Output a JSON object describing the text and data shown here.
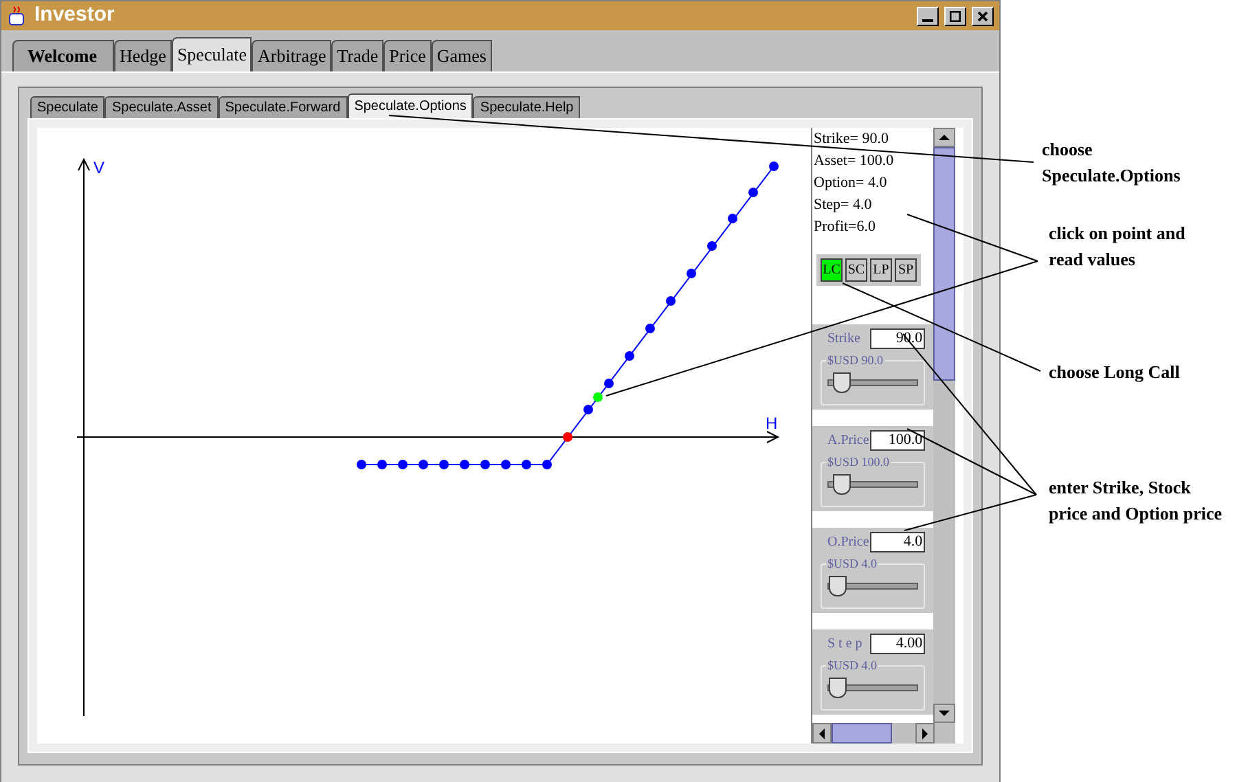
{
  "window": {
    "title": "Investor"
  },
  "main_tabs": [
    {
      "label": "Welcome",
      "selected": false,
      "bold": true
    },
    {
      "label": "Hedge",
      "selected": false,
      "bold": false
    },
    {
      "label": "Speculate",
      "selected": true,
      "bold": false
    },
    {
      "label": "Arbitrage",
      "selected": false,
      "bold": false
    },
    {
      "label": "Trade",
      "selected": false,
      "bold": false
    },
    {
      "label": "Price",
      "selected": false,
      "bold": false
    },
    {
      "label": "Games",
      "selected": false,
      "bold": false
    }
  ],
  "sub_tabs": [
    {
      "label": "Speculate",
      "selected": false
    },
    {
      "label": "Speculate.Asset",
      "selected": false
    },
    {
      "label": "Speculate.Forward",
      "selected": false
    },
    {
      "label": "Speculate.Options",
      "selected": true
    },
    {
      "label": "Speculate.Help",
      "selected": false
    }
  ],
  "plot": {
    "x_axis_label": "H",
    "y_axis_label": "V"
  },
  "readout": [
    "Strike= 90.0",
    "Asset= 100.0",
    "Option= 4.0",
    "Step= 4.0",
    "Profit=6.0"
  ],
  "position_buttons": [
    {
      "label": "LC",
      "selected": true
    },
    {
      "label": "SC",
      "selected": false
    },
    {
      "label": "LP",
      "selected": false
    },
    {
      "label": "SP",
      "selected": false
    }
  ],
  "inputs": [
    {
      "label": "Strike",
      "value": "90.0",
      "slider_title": "$USD 90.0",
      "level": 0.06
    },
    {
      "label": "A.Price",
      "value": "100.0",
      "slider_title": "$USD 100.0",
      "level": 0.06
    },
    {
      "label": "O.Price",
      "value": "4.0",
      "slider_title": "$USD 4.0",
      "level": 0.0
    },
    {
      "label": "S t e p",
      "value": "4.00",
      "slider_title": "$USD 4.0",
      "level": 0.0
    }
  ],
  "annotations": [
    {
      "lines": [
        "choose",
        "Speculate.Options"
      ]
    },
    {
      "lines": [
        "click on point and",
        "read values"
      ]
    },
    {
      "lines": [
        "choose Long Call"
      ]
    },
    {
      "lines": [
        "enter Strike, Stock",
        "price and Option price"
      ]
    }
  ]
}
